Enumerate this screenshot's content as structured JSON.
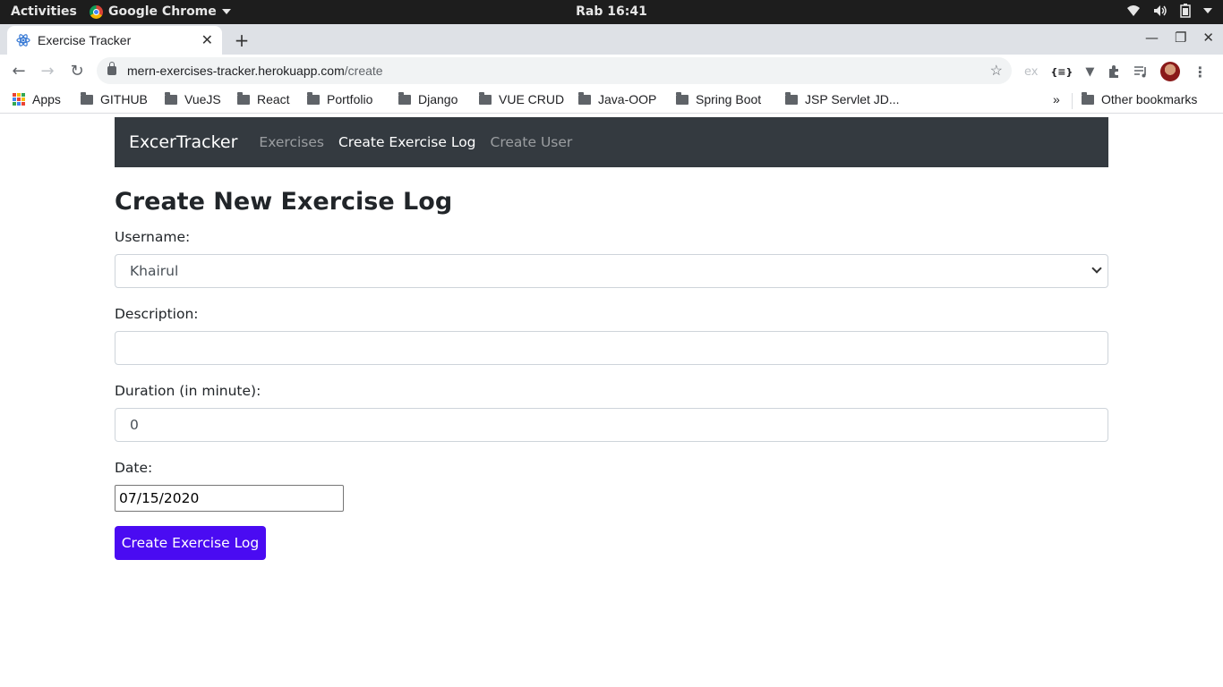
{
  "system_bar": {
    "activities": "Activities",
    "app_name": "Google Chrome",
    "clock": "Rab 16:41"
  },
  "browser": {
    "tab_title": "Exercise Tracker",
    "url_host": "mern-exercises-tracker.herokuapp.com",
    "url_path": "/create",
    "extension_ex": "ex",
    "extension_json": "{≡}"
  },
  "bookmarks": {
    "items": [
      "Apps",
      "GITHUB",
      "VueJS",
      "React",
      "Portfolio",
      "Django",
      "VUE CRUD",
      "Java-OOP",
      "Spring Boot",
      "JSP Servlet JD..."
    ],
    "overflow": "»",
    "other": "Other bookmarks"
  },
  "navbar": {
    "brand": "ExcerTracker",
    "links": [
      "Exercises",
      "Create Exercise Log",
      "Create User"
    ],
    "active_index": 1
  },
  "form": {
    "title": "Create New Exercise Log",
    "username_label": "Username:",
    "username_value": "Khairul",
    "description_label": "Description:",
    "description_value": "",
    "duration_label": "Duration (in minute):",
    "duration_value": "0",
    "date_label": "Date:",
    "date_value": "07/15/2020",
    "submit_label": "Create Exercise Log"
  },
  "colors": {
    "navbar_bg": "#343a40",
    "button_bg": "#4a0bf2"
  }
}
